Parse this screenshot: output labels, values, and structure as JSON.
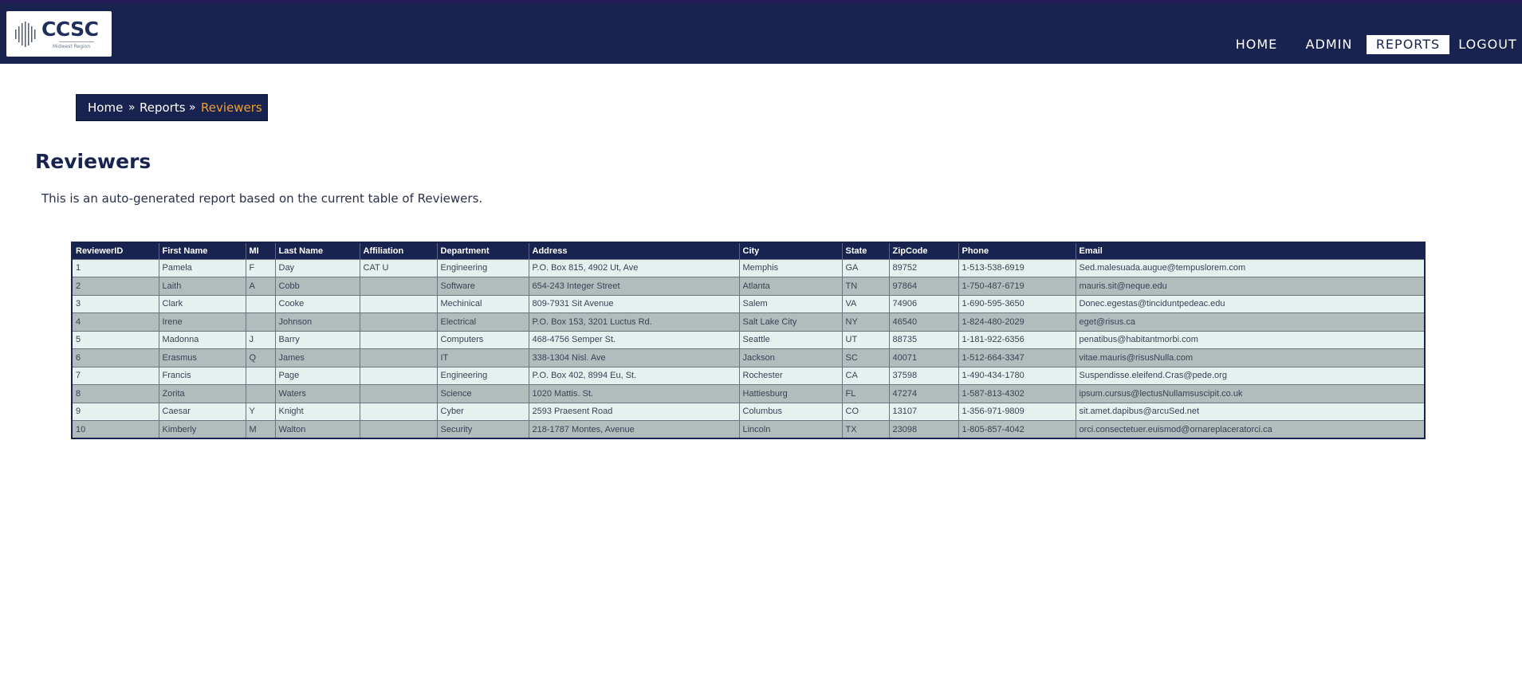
{
  "header": {
    "logo_text": "CCSC",
    "logo_subtext": "Midwest Region",
    "nav": [
      {
        "label": "HOME",
        "active": false
      },
      {
        "label": "ADMIN",
        "active": false
      },
      {
        "label": "REPORTS",
        "active": true
      },
      {
        "label": "LOGOUT",
        "active": false
      }
    ]
  },
  "breadcrumb": {
    "items": [
      "Home",
      "Reports",
      "Reviewers"
    ],
    "separator": "»"
  },
  "page": {
    "title": "Reviewers",
    "description": "This is an auto-generated report based on the current table of Reviewers."
  },
  "table": {
    "columns": [
      "ReviewerID",
      "First Name",
      "MI",
      "Last Name",
      "Affiliation",
      "Department",
      "Address",
      "City",
      "State",
      "ZipCode",
      "Phone",
      "Email"
    ],
    "rows": [
      [
        "1",
        "Pamela",
        "F",
        "Day",
        "CAT U",
        "Engineering",
        "P.O. Box 815, 4902 Ut, Ave",
        "Memphis",
        "GA",
        "89752",
        "1-513-538-6919",
        "Sed.malesuada.augue@tempuslorem.com"
      ],
      [
        "2",
        "Laith",
        "A",
        "Cobb",
        "",
        "Software",
        "654-243 Integer Street",
        "Atlanta",
        "TN",
        "97864",
        "1-750-487-6719",
        "mauris.sit@neque.edu"
      ],
      [
        "3",
        "Clark",
        "",
        "Cooke",
        "",
        "Mechinical",
        "809-7931 Sit Avenue",
        "Salem",
        "VA",
        "74906",
        "1-690-595-3650",
        "Donec.egestas@tinciduntpedeac.edu"
      ],
      [
        "4",
        "Irene",
        "",
        "Johnson",
        "",
        "Electrical",
        "P.O. Box 153, 3201 Luctus Rd.",
        "Salt Lake City",
        "NY",
        "46540",
        "1-824-480-2029",
        "eget@risus.ca"
      ],
      [
        "5",
        "Madonna",
        "J",
        "Barry",
        "",
        "Computers",
        "468-4756 Semper St.",
        "Seattle",
        "UT",
        "88735",
        "1-181-922-6356",
        "penatibus@habitantmorbi.com"
      ],
      [
        "6",
        "Erasmus",
        "Q",
        "James",
        "",
        "IT",
        "338-1304 Nisl. Ave",
        "Jackson",
        "SC",
        "40071",
        "1-512-664-3347",
        "vitae.mauris@risusNulla.com"
      ],
      [
        "7",
        "Francis",
        "",
        "Page",
        "",
        "Engineering",
        "P.O. Box 402, 8994 Eu, St.",
        "Rochester",
        "CA",
        "37598",
        "1-490-434-1780",
        "Suspendisse.eleifend.Cras@pede.org"
      ],
      [
        "8",
        "Zorita",
        "",
        "Waters",
        "",
        "Science",
        "1020 Mattis. St.",
        "Hattiesburg",
        "FL",
        "47274",
        "1-587-813-4302",
        "ipsum.cursus@lectusNullamsuscipit.co.uk"
      ],
      [
        "9",
        "Caesar",
        "Y",
        "Knight",
        "",
        "Cyber",
        "2593 Praesent Road",
        "Columbus",
        "CO",
        "13107",
        "1-356-971-9809",
        "sit.amet.dapibus@arcuSed.net"
      ],
      [
        "10",
        "Kimberly",
        "M",
        "Walton",
        "",
        "Security",
        "218-1787 Montes, Avenue",
        "Lincoln",
        "TX",
        "23098",
        "1-805-857-4042",
        "orci.consectetuer.euismod@ornareplaceratorci.ca"
      ]
    ]
  }
}
